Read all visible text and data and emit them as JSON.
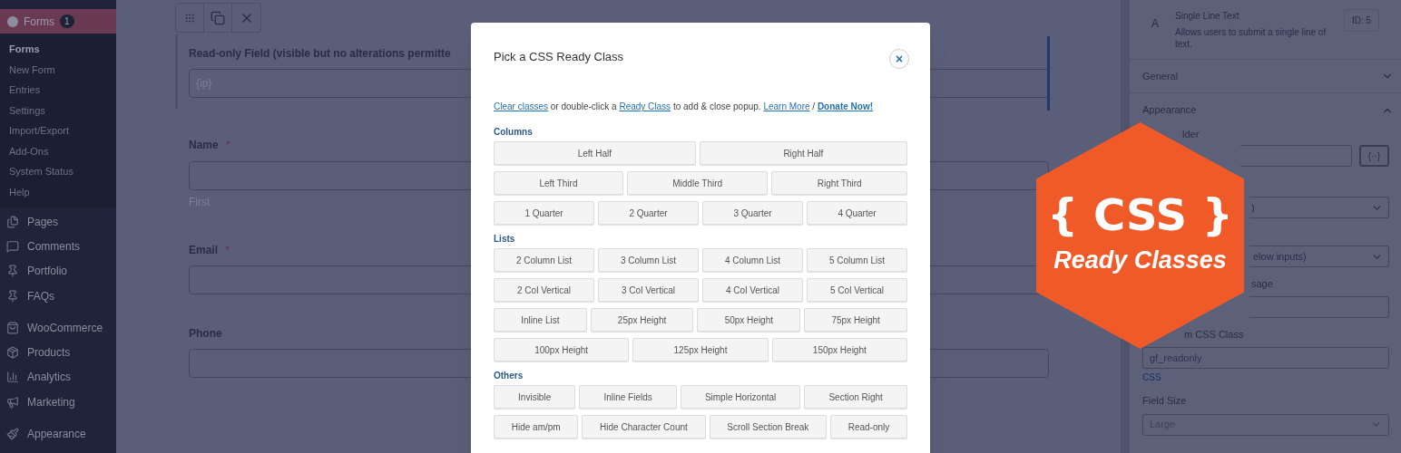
{
  "sidebar": {
    "menu": {
      "label": "Forms",
      "badge": "1",
      "selected": true
    },
    "submenu": [
      {
        "label": "Forms",
        "selected": true
      },
      {
        "label": "New Form",
        "selected": false
      },
      {
        "label": "Entries",
        "selected": false
      },
      {
        "label": "Settings",
        "selected": false
      },
      {
        "label": "Import/Export",
        "selected": false
      },
      {
        "label": "Add-Ons",
        "selected": false
      },
      {
        "label": "System Status",
        "selected": false
      },
      {
        "label": "Help",
        "selected": false
      }
    ],
    "item_groups": [
      {
        "items": [
          {
            "label": "Pages",
            "kind": "pages"
          },
          {
            "label": "Comments",
            "kind": "comments"
          },
          {
            "label": "Portfolio",
            "kind": "pin"
          },
          {
            "label": "FAQs",
            "kind": "pin"
          }
        ]
      },
      {
        "items": [
          {
            "label": "WooCommerce",
            "kind": "woo"
          },
          {
            "label": "Products",
            "kind": "box"
          },
          {
            "label": "Analytics",
            "kind": "chart"
          },
          {
            "label": "Marketing",
            "kind": "megaphone"
          }
        ]
      },
      {
        "items": [
          {
            "label": "Appearance",
            "kind": "brush"
          }
        ]
      }
    ]
  },
  "canvas": {
    "required_mark": "*",
    "fields": [
      {
        "label": "Read-only Field (visible but no alterations permitte",
        "required": false,
        "selected": true,
        "value": "{ip}"
      },
      {
        "label": "Name",
        "required": true,
        "selected": false,
        "sublabel": "First"
      },
      {
        "label": "Email",
        "required": true,
        "selected": false
      },
      {
        "label": "Phone",
        "required": false,
        "selected": false
      }
    ]
  },
  "modal": {
    "title": "Pick a CSS Ready Class",
    "close": "×",
    "intro": [
      {
        "kind": "link",
        "text": "Clear classes"
      },
      {
        "kind": "text",
        "text": " or double-click a "
      },
      {
        "kind": "link",
        "text": "Ready Class"
      },
      {
        "kind": "text",
        "text": " to add & close popup. "
      },
      {
        "kind": "link",
        "text": "Learn More"
      },
      {
        "kind": "text",
        "text": " / "
      },
      {
        "kind": "strong_link",
        "text": "Donate Now!"
      }
    ],
    "sections": [
      {
        "title": "Columns",
        "button_rows": [
          {
            "buttons": [
              "Left Half",
              "Right Half"
            ]
          },
          {
            "buttons": [
              "Left Third",
              "Middle Third",
              "Right Third"
            ]
          },
          {
            "buttons": [
              "1 Quarter",
              "2 Quarter",
              "3 Quarter",
              "4 Quarter"
            ]
          }
        ]
      },
      {
        "title": "Lists",
        "button_rows": [
          {
            "buttons": [
              "2 Column List",
              "3 Column List",
              "4 Column List",
              "5 Column List"
            ]
          },
          {
            "buttons": [
              "2 Col Vertical",
              "3 Col Vertical",
              "4 Col Vertical",
              "5 Col Vertical"
            ]
          },
          {
            "buttons": [
              "Inline List",
              "25px Height",
              "50px Height",
              "75px Height"
            ]
          },
          {
            "buttons": [
              "100px Height",
              "125px Height",
              "150px Height"
            ]
          }
        ]
      },
      {
        "title": "Others",
        "button_rows": [
          {
            "buttons": [
              "Invisible",
              "Inline Fields",
              "Simple Horizontal",
              "Section Right"
            ]
          },
          {
            "buttons": [
              "Hide am/pm",
              "Hide Character Count",
              "Scroll Section Break",
              "Read-only"
            ]
          }
        ]
      }
    ]
  },
  "settings": {
    "field_type": {
      "icon": "A",
      "name": "Single Line Text",
      "description": "Allows users to submit a single line of text.",
      "id": "ID: 5"
    },
    "sections": [
      {
        "title": "General",
        "expanded": false
      },
      {
        "title": "Appearance",
        "expanded": true
      }
    ],
    "placeholder_label": "lder",
    "merge_tag": "{··}",
    "select_1": ")",
    "select_2": "elow inputs)",
    "label_3": "sage",
    "label_4": "m CSS Class",
    "css_class": "gf_readonly",
    "css_link": "CSS",
    "field_size_label": "Field Size",
    "field_size": "Large"
  },
  "badge": {
    "line_1": "{ CSS }",
    "line_2": "Ready Classes"
  }
}
